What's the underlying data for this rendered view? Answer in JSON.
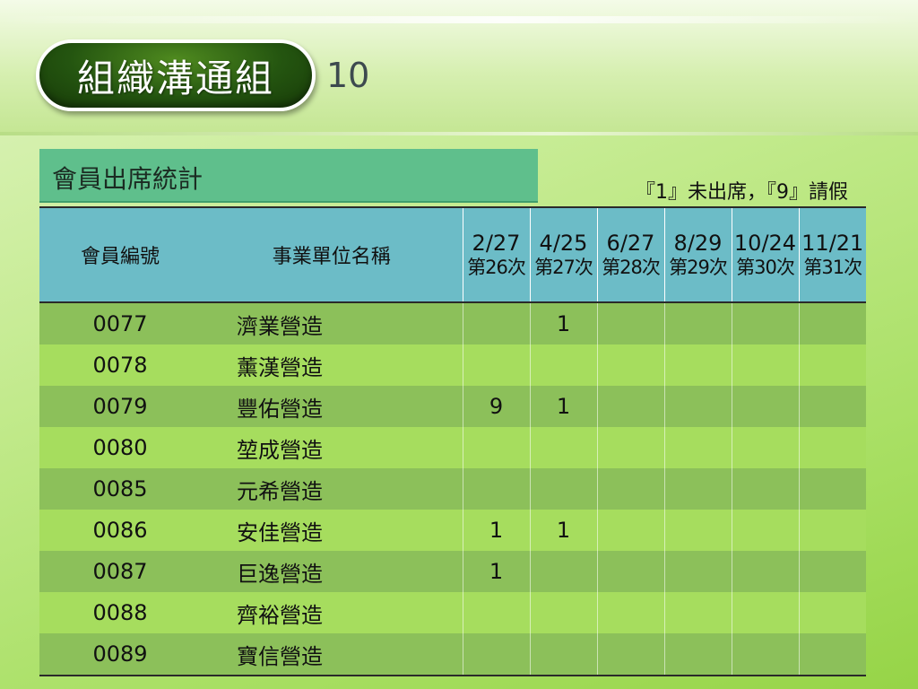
{
  "slide": {
    "title": "組織溝通組",
    "page_number": "10"
  },
  "section": {
    "header": "會員出席統計",
    "legend": "『1』未出席，『9』請假"
  },
  "table": {
    "columns": {
      "id": "會員編號",
      "name": "事業單位名稱"
    },
    "dates": [
      {
        "date": "2/27",
        "session": "第26次"
      },
      {
        "date": "4/25",
        "session": "第27次"
      },
      {
        "date": "6/27",
        "session": "第28次"
      },
      {
        "date": "8/29",
        "session": "第29次"
      },
      {
        "date": "10/24",
        "session": "第30次"
      },
      {
        "date": "11/21",
        "session": "第31次"
      }
    ],
    "rows": [
      {
        "id": "0077",
        "name": "濟業營造",
        "vals": [
          "",
          "1",
          "",
          "",
          "",
          ""
        ]
      },
      {
        "id": "0078",
        "name": "薰漢營造",
        "vals": [
          "",
          "",
          "",
          "",
          "",
          ""
        ]
      },
      {
        "id": "0079",
        "name": "豐佑營造",
        "vals": [
          "9",
          "1",
          "",
          "",
          "",
          ""
        ]
      },
      {
        "id": "0080",
        "name": "堃成營造",
        "vals": [
          "",
          "",
          "",
          "",
          "",
          ""
        ]
      },
      {
        "id": "0085",
        "name": "元希營造",
        "vals": [
          "",
          "",
          "",
          "",
          "",
          ""
        ]
      },
      {
        "id": "0086",
        "name": "安佳營造",
        "vals": [
          "1",
          "1",
          "",
          "",
          "",
          ""
        ]
      },
      {
        "id": "0087",
        "name": "巨逸營造",
        "vals": [
          "1",
          "",
          "",
          "",
          "",
          ""
        ]
      },
      {
        "id": "0088",
        "name": "齊裕營造",
        "vals": [
          "",
          "",
          "",
          "",
          "",
          ""
        ]
      },
      {
        "id": "0089",
        "name": "寶信營造",
        "vals": [
          "",
          "",
          "",
          "",
          "",
          ""
        ]
      }
    ]
  }
}
